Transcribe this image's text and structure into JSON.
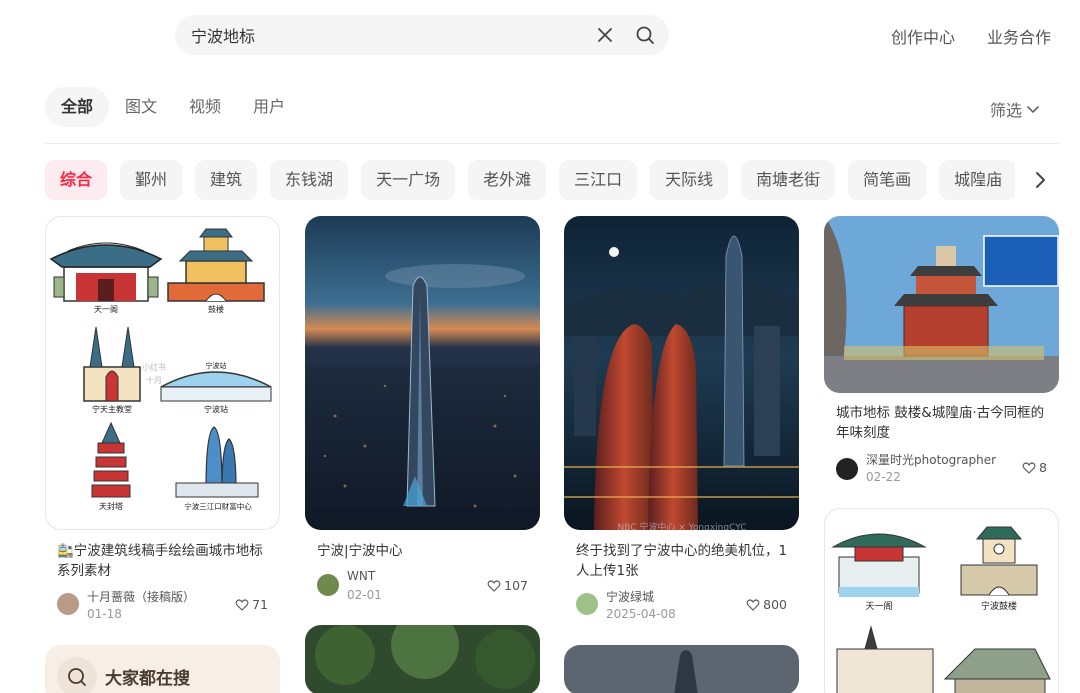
{
  "search": {
    "value": "宁波地标"
  },
  "header": {
    "links": [
      "创作中心",
      "业务合作"
    ]
  },
  "type_tabs": [
    "全部",
    "图文",
    "视频",
    "用户"
  ],
  "filter_label": "筛选",
  "chips": [
    "综合",
    "鄞州",
    "建筑",
    "东钱湖",
    "天一广场",
    "老外滩",
    "三江口",
    "天际线",
    "南塘老街",
    "简笔画",
    "城隍庙"
  ],
  "feed": {
    "c1": {
      "title": "🚉宁波建筑线稿手绘绘画城市地标系列素材",
      "author": "十月蔷薇（接稿版）",
      "date": "01-18",
      "likes": "71",
      "img_labels": [
        "天一阁",
        "鼓楼",
        "宁天主教堂",
        "宁波站",
        "宁波站",
        "天封塔",
        "宁波三江口财富中心"
      ],
      "watermark": "小红书\n十月"
    },
    "c2": {
      "title": "宁波|宁波中心",
      "author": "WNT",
      "date": "02-01",
      "likes": "107"
    },
    "c3": {
      "title": "终于找到了宁波中心的绝美机位，1人上传1张",
      "author": "宁波绿城",
      "date": "2025-04-08",
      "likes": "800"
    },
    "c4": {
      "title": "城市地标 鼓楼&城隍庙·古今同框的年味刻度",
      "author": "深量时光photographer",
      "date": "02-22",
      "likes": "8"
    },
    "c5": {
      "img_labels": [
        "天一阁",
        "宁波鼓楼"
      ]
    }
  },
  "popular": {
    "title": "大家都在搜"
  },
  "colors": {
    "accent": "#ff2442",
    "chip_bg": "#f5f5f5"
  },
  "icons": [
    "clear-icon",
    "search-icon",
    "chevron-down-icon",
    "chevron-right-icon",
    "heart-icon"
  ]
}
